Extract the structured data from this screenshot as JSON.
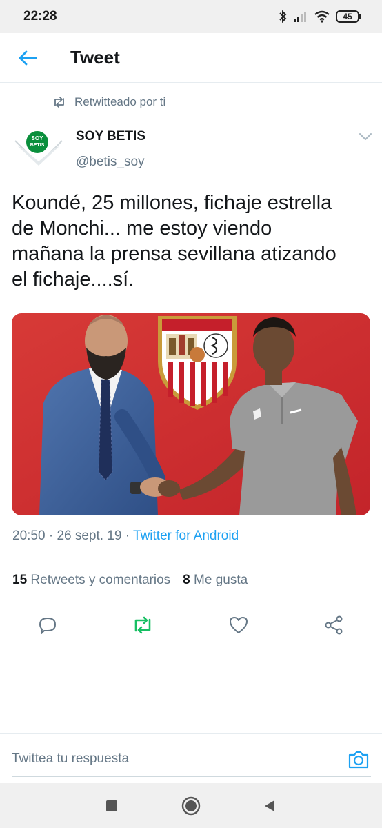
{
  "status_bar": {
    "time": "22:28",
    "battery": "45"
  },
  "header": {
    "title": "Tweet"
  },
  "retweet": {
    "label": "Retwitteado por ti"
  },
  "author": {
    "name": "SOY BETIS",
    "handle": "@betis_soy",
    "avatar_text_1": "SOY",
    "avatar_text_2": "BETIS"
  },
  "tweet": {
    "lines": [
      "Koundé, 25 millones, fichaje estrella",
      "de Monchi... me estoy viendo",
      "mañana la prensa sevillana atizando",
      "el fichaje....sí."
    ],
    "time": "20:50",
    "date": "26 sept. 19",
    "separator": "·",
    "source": "Twitter for Android"
  },
  "stats": {
    "retweets_count": "15",
    "retweets_label": "Retweets y comentarios",
    "likes_count": "8",
    "likes_label": "Me gusta"
  },
  "actions": [
    "reply-icon",
    "retweet-icon",
    "like-icon",
    "share-icon"
  ],
  "reply": {
    "placeholder": "Twittea tu respuesta"
  },
  "colors": {
    "accent": "#1da1f2",
    "retweet_green": "#17bf63",
    "muted": "#657786",
    "text": "#14171a",
    "media_bg": "#d2282e"
  }
}
